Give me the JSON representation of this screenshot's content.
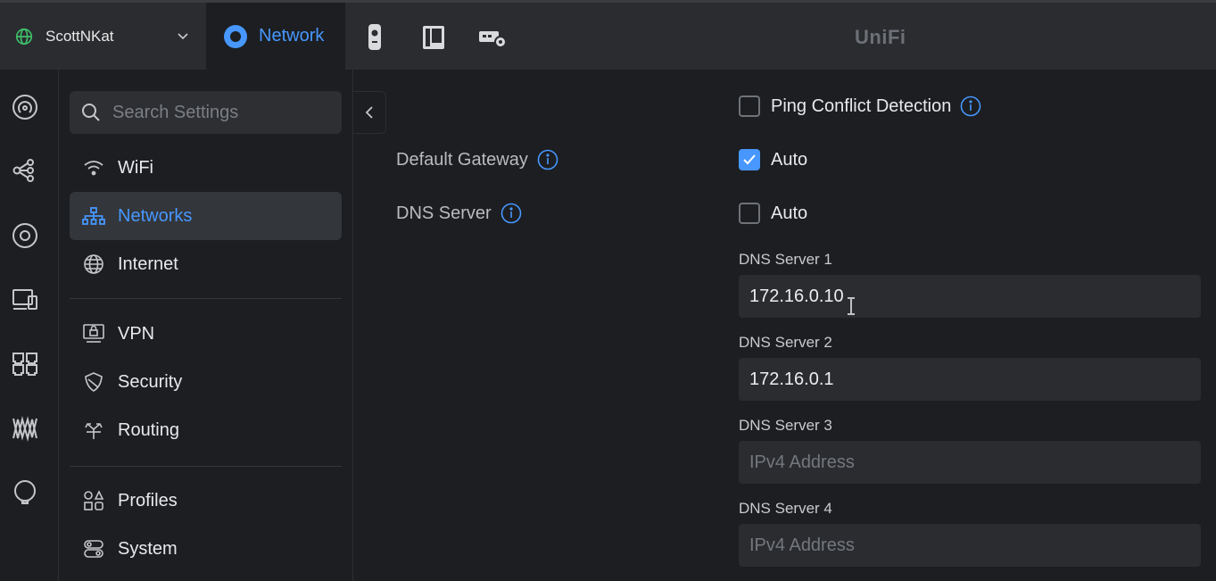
{
  "topbar": {
    "site_name": "ScottNKat",
    "active_app": "Network",
    "brand": "UniFi",
    "apps": [
      "protect-app-icon",
      "access-app-icon",
      "site-manager-icon"
    ]
  },
  "search": {
    "placeholder": "Search Settings"
  },
  "sidebar": {
    "items": [
      {
        "label": "WiFi",
        "icon": "wifi-icon"
      },
      {
        "label": "Networks",
        "icon": "networks-icon",
        "active": true
      },
      {
        "label": "Internet",
        "icon": "internet-globe-icon"
      },
      {
        "label": "VPN",
        "icon": "vpn-icon"
      },
      {
        "label": "Security",
        "icon": "shield-icon"
      },
      {
        "label": "Routing",
        "icon": "routing-icon"
      },
      {
        "label": "Profiles",
        "icon": "profiles-icon"
      },
      {
        "label": "System",
        "icon": "system-icon"
      }
    ]
  },
  "form": {
    "ping_conflict": {
      "label": "Ping Conflict Detection",
      "checked": false
    },
    "default_gateway": {
      "label": "Default Gateway",
      "auto_label": "Auto",
      "checked": true
    },
    "dns_server": {
      "label": "DNS Server",
      "auto_label": "Auto",
      "checked": false
    },
    "dns_fields": [
      {
        "label": "DNS Server 1",
        "value": "172.16.0.10",
        "placeholder": "IPv4 Address"
      },
      {
        "label": "DNS Server 2",
        "value": "172.16.0.1",
        "placeholder": "IPv4 Address"
      },
      {
        "label": "DNS Server 3",
        "value": "",
        "placeholder": "IPv4 Address"
      },
      {
        "label": "DNS Server 4",
        "value": "",
        "placeholder": "IPv4 Address"
      }
    ]
  },
  "colors": {
    "accent": "#4797ff",
    "background": "#1c1e21",
    "topbar": "#2a2c30",
    "field": "#2a2c30"
  }
}
